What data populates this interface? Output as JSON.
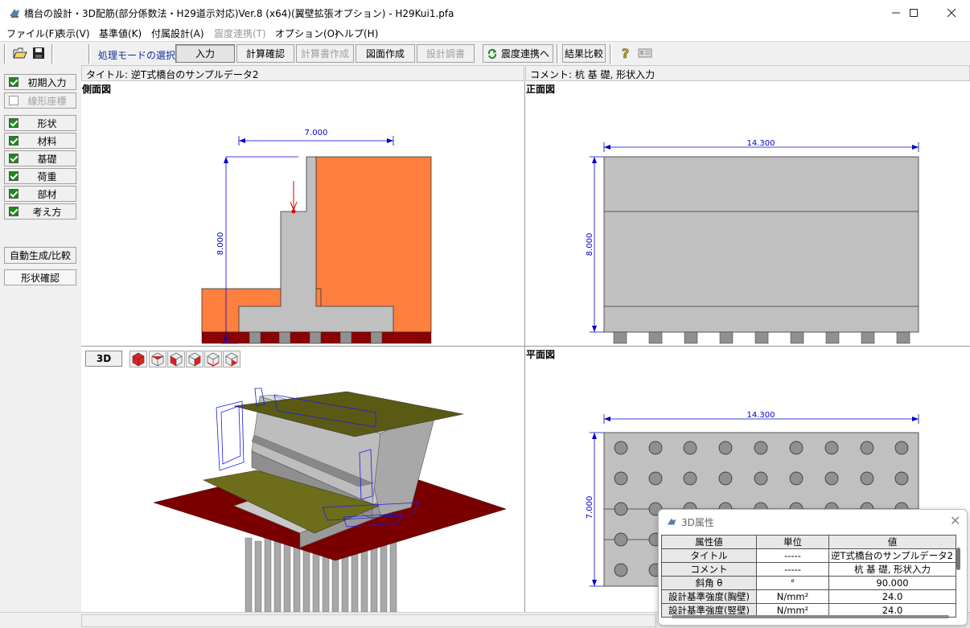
{
  "window": {
    "title": "橋台の設計・3D配筋(部分係数法・H29道示対応)Ver.8 (x64)(翼壁拡張オプション) - H29Kui1.pfa",
    "minimize_icon": "minimize-icon",
    "maximize_icon": "maximize-icon",
    "close_icon": "close-icon"
  },
  "menu": {
    "items": [
      {
        "label": "ファイル(F)",
        "enabled": true
      },
      {
        "label": "表示(V)",
        "enabled": true
      },
      {
        "label": "基準値(K)",
        "enabled": true
      },
      {
        "label": "付属設計(A)",
        "enabled": true
      },
      {
        "label": "震度連携(T)",
        "enabled": false
      },
      {
        "label": "オプション(O)",
        "enabled": true
      },
      {
        "label": "ヘルプ(H)",
        "enabled": true
      }
    ]
  },
  "toolbar": {
    "mode_label": "処理モードの選択",
    "buttons": [
      {
        "label": "入力",
        "state": "pressed"
      },
      {
        "label": "計算確認",
        "state": "normal"
      },
      {
        "label": "計算書作成",
        "state": "disabled"
      },
      {
        "label": "図面作成",
        "state": "normal"
      },
      {
        "label": "設計調書",
        "state": "disabled"
      },
      {
        "label": "震度連携へ",
        "state": "normal"
      },
      {
        "label": "結果比較",
        "state": "normal"
      }
    ]
  },
  "left_panel": {
    "items": [
      {
        "label": "初期入力",
        "checked": true,
        "enabled": true
      },
      {
        "label": "線形座標",
        "checked": false,
        "enabled": false
      },
      {
        "label": "形状",
        "checked": true,
        "enabled": true
      },
      {
        "label": "材料",
        "checked": true,
        "enabled": true
      },
      {
        "label": "基礎",
        "checked": true,
        "enabled": true
      },
      {
        "label": "荷重",
        "checked": true,
        "enabled": true
      },
      {
        "label": "部材",
        "checked": true,
        "enabled": true
      },
      {
        "label": "考え方",
        "checked": true,
        "enabled": true
      }
    ],
    "auto_button": "自動生成/比較",
    "shape_check_button": "形状確認"
  },
  "header": {
    "title_label": "タイトル: 逆T式橋台のサンプルデータ2",
    "comment_label": "コメント: 杭 基 礎, 形状入力"
  },
  "views": {
    "side": {
      "label": "側面図",
      "dim_width": "7.000",
      "dim_height": "8.000"
    },
    "front": {
      "label": "正面図",
      "dim_width": "14.300",
      "dim_height": "8.000"
    },
    "three_d": {
      "button_label": "3D"
    },
    "plan": {
      "label": "平面図",
      "dim_width": "14.300",
      "dim_height": "7.000"
    }
  },
  "colors": {
    "soil": "#ff7f3f",
    "concrete": "#c0c0c0",
    "footing_dark": "#8b0000",
    "dim_blue": "#0000cc",
    "pile_gray": "#909090",
    "approach_slab": "#7a7a1a"
  },
  "attr_panel": {
    "title": "3D属性",
    "columns": [
      "属性値",
      "単位",
      "値"
    ],
    "rows": [
      {
        "key": "タイトル",
        "unit": "-----",
        "value": "逆T式橋台のサンプルデータ2"
      },
      {
        "key": "コメント",
        "unit": "-----",
        "value": "杭 基 礎, 形状入力"
      },
      {
        "key": "斜角 θ",
        "unit": "°",
        "value": "90.000"
      },
      {
        "key": "設計基準強度(胸壁)",
        "unit": "N/mm²",
        "value": "24.0"
      },
      {
        "key": "設計基準強度(竪壁)",
        "unit": "N/mm²",
        "value": "24.0"
      }
    ]
  }
}
